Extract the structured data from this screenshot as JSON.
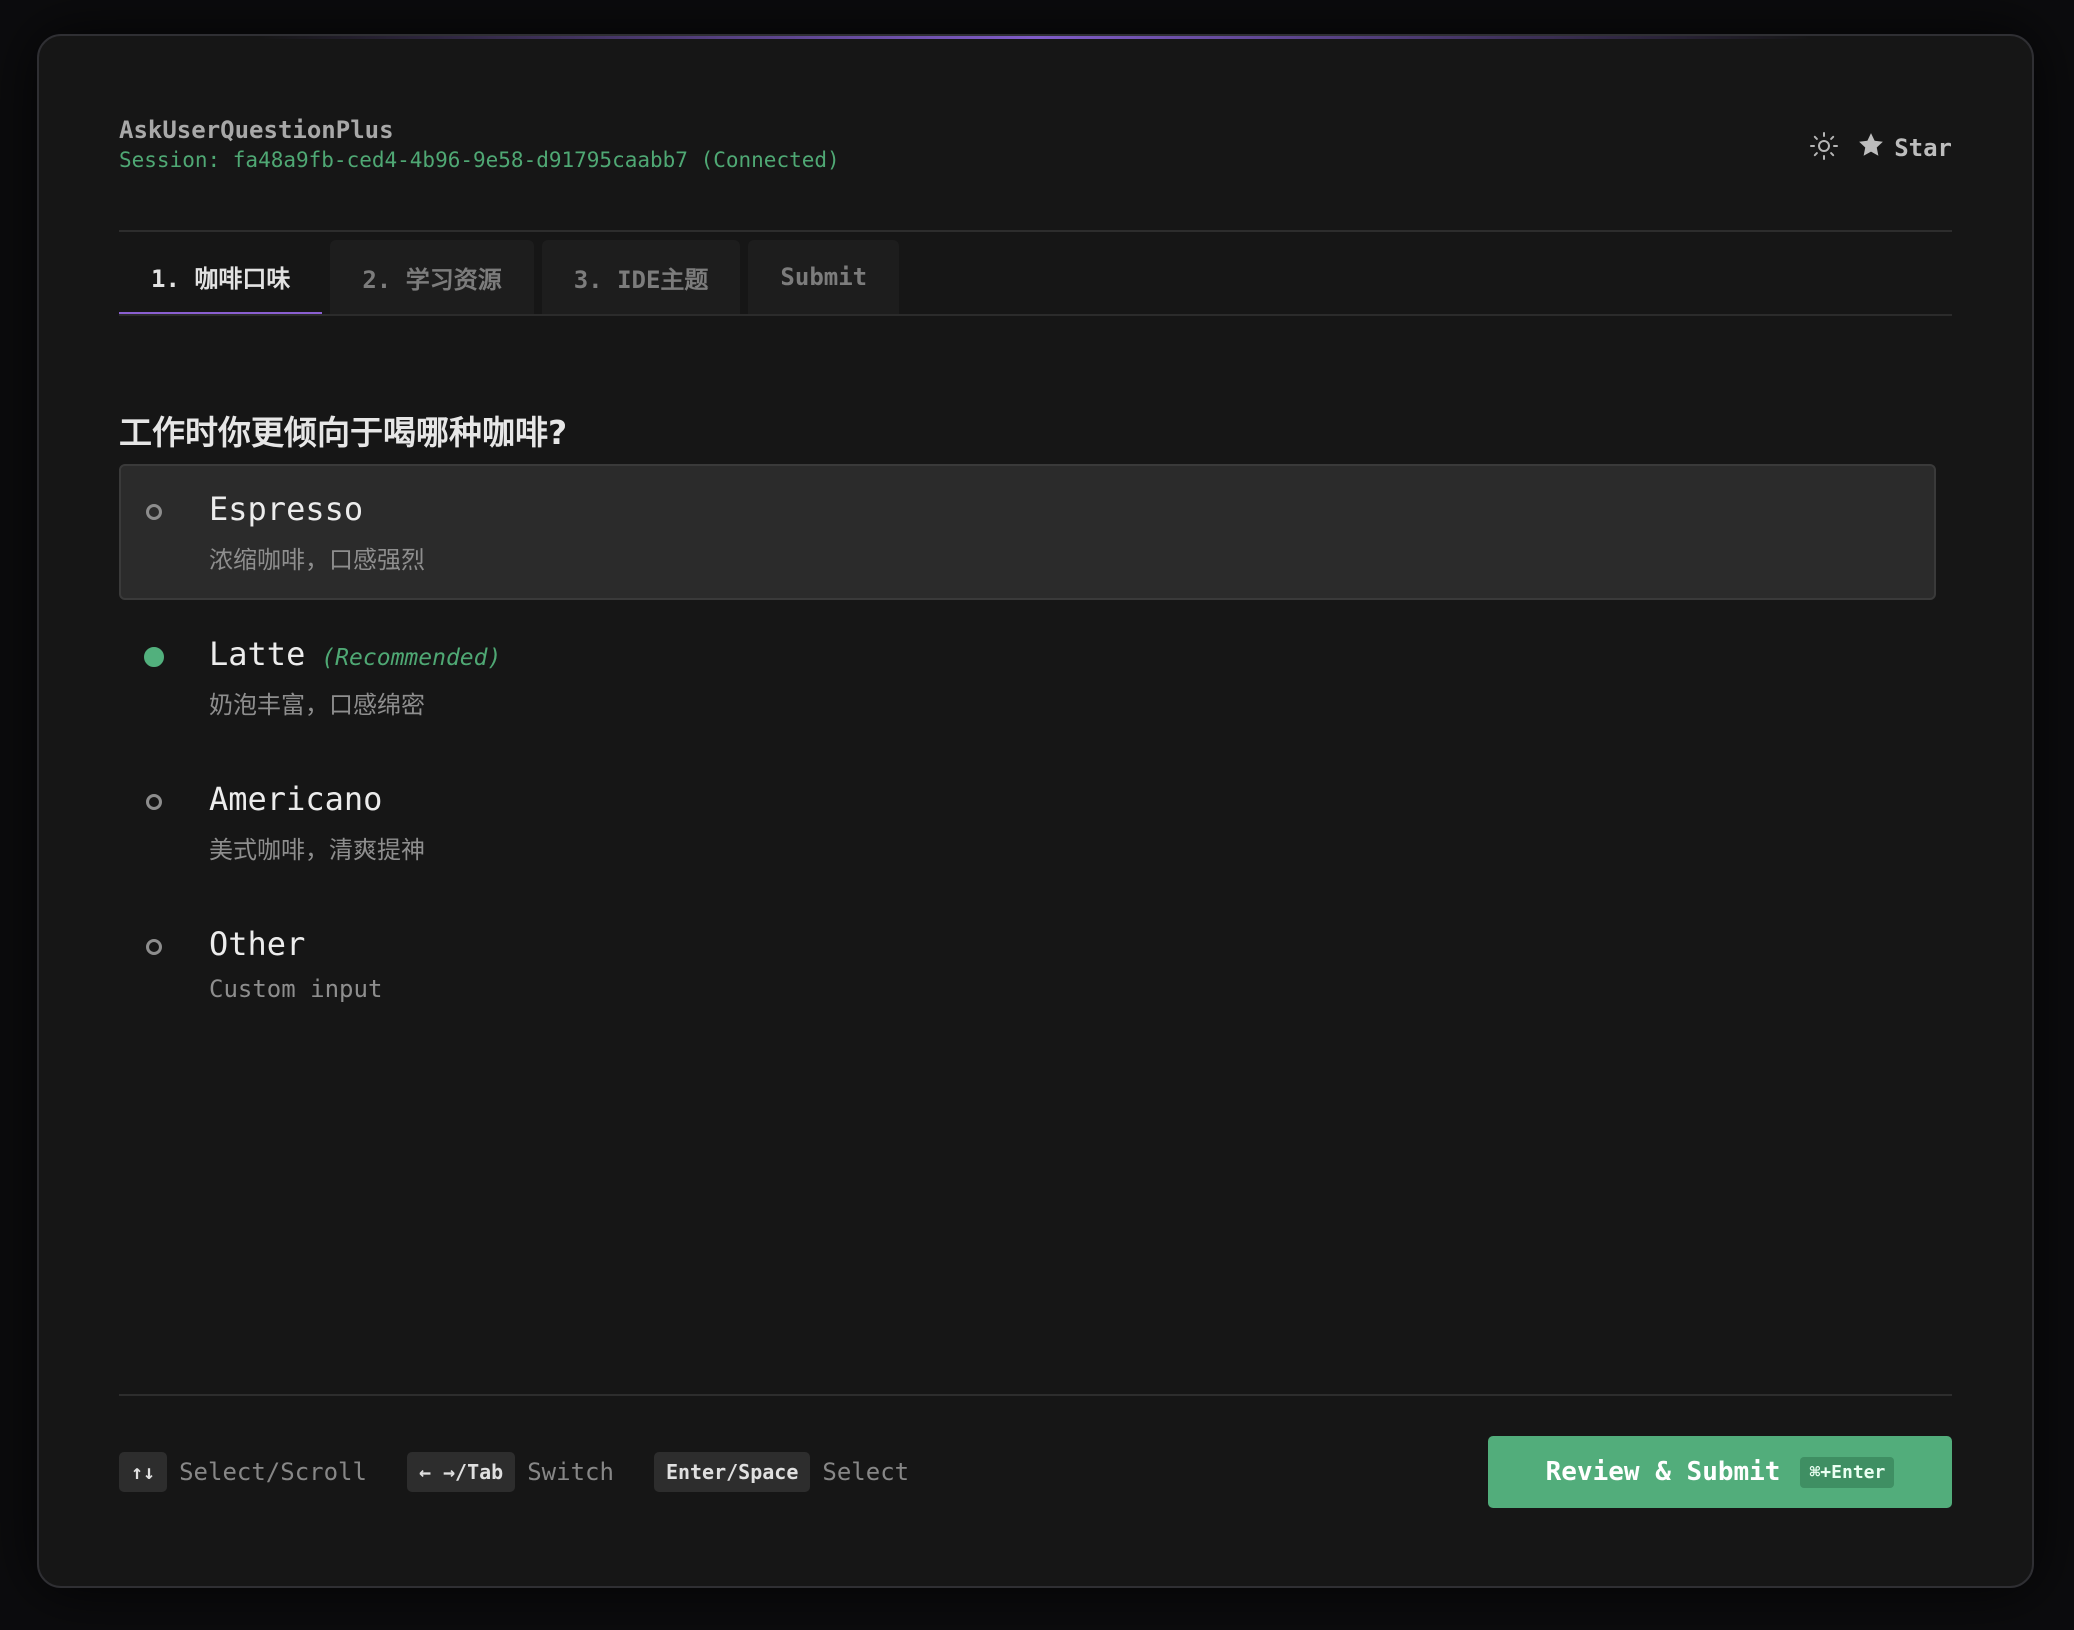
{
  "app": {
    "title": "AskUserQuestionPlus",
    "session": "Session: fa48a9fb-ced4-4b96-9e58-d91795caabb7 (Connected)"
  },
  "header": {
    "theme_icon": "sun-icon",
    "star_icon": "star-icon",
    "star_label": "Star"
  },
  "tabs": [
    {
      "label": "1. 咖啡口味",
      "active": true
    },
    {
      "label": "2. 学习资源",
      "active": false
    },
    {
      "label": "3. IDE主题",
      "active": false
    },
    {
      "label": "Submit",
      "active": false
    }
  ],
  "question": "工作时你更倾向于喝哪种咖啡?",
  "options": [
    {
      "label": "Espresso",
      "tag": "",
      "description": "浓缩咖啡，口感强烈",
      "selected": false,
      "hovered": true
    },
    {
      "label": "Latte",
      "tag": "(Recommended)",
      "description": "奶泡丰富，口感绵密",
      "selected": true,
      "hovered": false
    },
    {
      "label": "Americano",
      "tag": "",
      "description": "美式咖啡，清爽提神",
      "selected": false,
      "hovered": false
    },
    {
      "label": "Other",
      "tag": "",
      "description": "Custom input",
      "selected": false,
      "hovered": false
    }
  ],
  "footer": {
    "hints": [
      {
        "key": "↑↓",
        "label": "Select/Scroll"
      },
      {
        "key": "← →/Tab",
        "label": "Switch"
      },
      {
        "key": "Enter/Space",
        "label": "Select"
      }
    ],
    "submit_label": "Review & Submit",
    "submit_shortcut": "⌘+Enter"
  },
  "colors": {
    "accent_green": "#52ad7b",
    "accent_purple": "#8a5fd1",
    "background": "#161616"
  }
}
